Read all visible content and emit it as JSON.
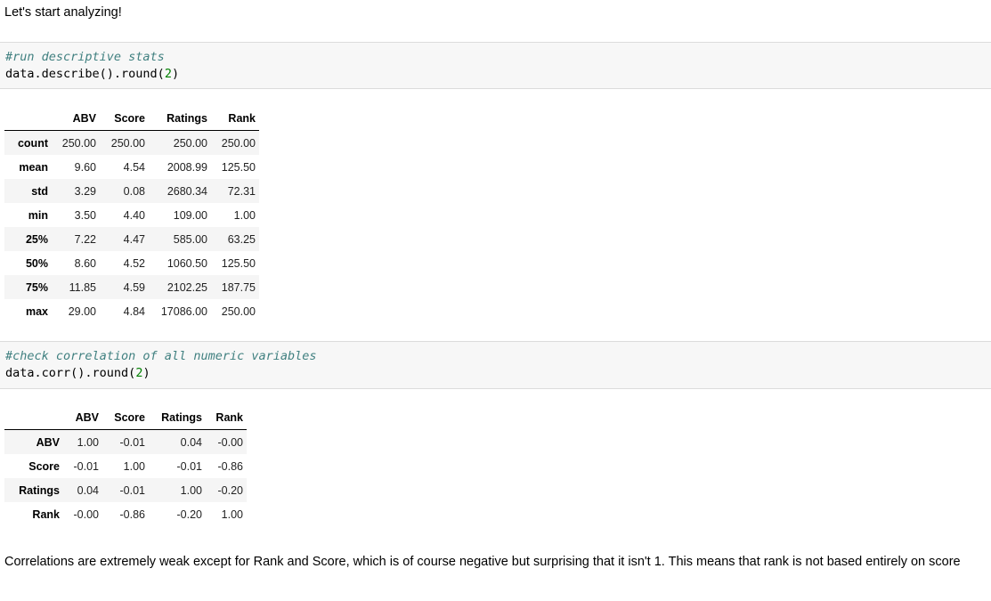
{
  "intro_text": "Let's start analyzing!",
  "cell1": {
    "comment": "#run descriptive stats",
    "code_prefix": "data.describe().round(",
    "code_arg": "2",
    "code_suffix": ")"
  },
  "describe_table": {
    "columns": [
      "",
      "ABV",
      "Score",
      "Ratings",
      "Rank"
    ],
    "rows": [
      {
        "label": "count",
        "values": [
          "250.00",
          "250.00",
          "250.00",
          "250.00"
        ]
      },
      {
        "label": "mean",
        "values": [
          "9.60",
          "4.54",
          "2008.99",
          "125.50"
        ]
      },
      {
        "label": "std",
        "values": [
          "3.29",
          "0.08",
          "2680.34",
          "72.31"
        ]
      },
      {
        "label": "min",
        "values": [
          "3.50",
          "4.40",
          "109.00",
          "1.00"
        ]
      },
      {
        "label": "25%",
        "values": [
          "7.22",
          "4.47",
          "585.00",
          "63.25"
        ]
      },
      {
        "label": "50%",
        "values": [
          "8.60",
          "4.52",
          "1060.50",
          "125.50"
        ]
      },
      {
        "label": "75%",
        "values": [
          "11.85",
          "4.59",
          "2102.25",
          "187.75"
        ]
      },
      {
        "label": "max",
        "values": [
          "29.00",
          "4.84",
          "17086.00",
          "250.00"
        ]
      }
    ]
  },
  "cell2": {
    "comment": "#check correlation of all numeric variables",
    "code_prefix": "data.corr().round(",
    "code_arg": "2",
    "code_suffix": ")"
  },
  "corr_table": {
    "columns": [
      "",
      "ABV",
      "Score",
      "Ratings",
      "Rank"
    ],
    "rows": [
      {
        "label": "ABV",
        "values": [
          "1.00",
          "-0.01",
          "0.04",
          "-0.00"
        ]
      },
      {
        "label": "Score",
        "values": [
          "-0.01",
          "1.00",
          "-0.01",
          "-0.86"
        ]
      },
      {
        "label": "Ratings",
        "values": [
          "0.04",
          "-0.01",
          "1.00",
          "-0.20"
        ]
      },
      {
        "label": "Rank",
        "values": [
          "-0.00",
          "-0.86",
          "-0.20",
          "1.00"
        ]
      }
    ]
  },
  "conclusion_text": "Correlations are extremely weak except for Rank and Score, which is of course negative but surprising that it isn't 1. This means that rank is not based entirely on score",
  "colors": {
    "comment": "#408080",
    "number": "#008000",
    "cell_background": "#f7f7f7"
  }
}
